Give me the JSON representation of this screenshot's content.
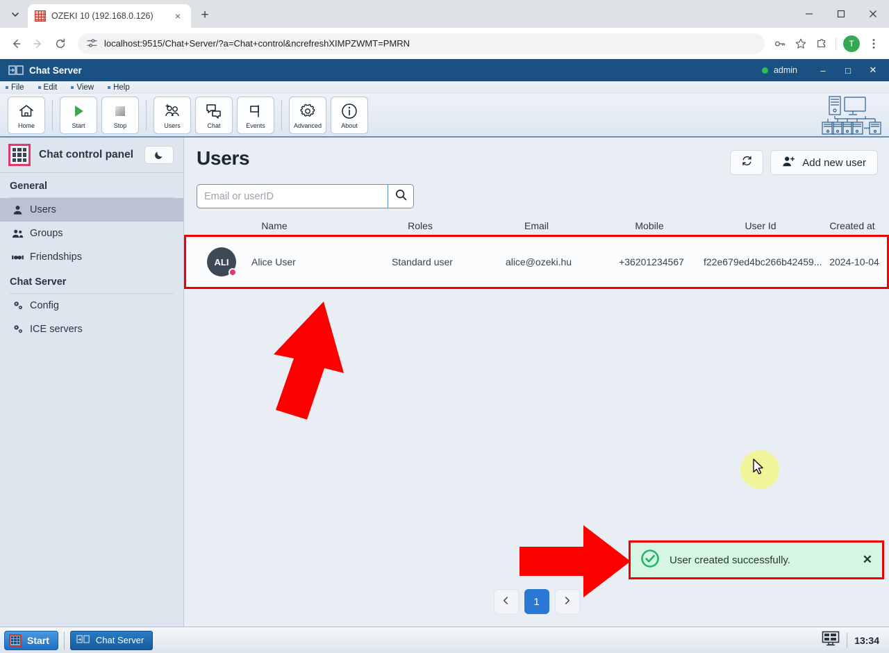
{
  "browser": {
    "tab": {
      "title": "OZEKI 10 (192.168.0.126)",
      "favicon": "ozeki-grid-icon",
      "close": "×"
    },
    "new_tab_label": "+",
    "tab_search_icon": "chevron-down-icon",
    "url": "localhost:9515/Chat+Server/?a=Chat+control&ncrefreshXIMPZWMT=PMRN",
    "site_info_icon": "site-settings-icon",
    "back_icon": "back-arrow-icon",
    "forward_icon": "forward-arrow-icon",
    "reload_icon": "reload-icon",
    "password_icon": "key-icon",
    "bookmark_icon": "star-icon",
    "extensions_icon": "puzzle-icon",
    "profile_initial": "T",
    "menu_icon": "three-dot-menu-icon",
    "window": {
      "minimize": "─",
      "maximize": "□",
      "close": "✕"
    }
  },
  "app": {
    "title": "Chat Server",
    "logo_icon": "chat-server-logo-icon",
    "status_indicator": "online-dot",
    "admin_label": "admin",
    "window_controls": {
      "minimize": "–",
      "maximize": "□",
      "close": "✕"
    },
    "menus": [
      "File",
      "Edit",
      "View",
      "Help"
    ],
    "toolbar": [
      {
        "label": "Home",
        "icon": "home-icon"
      },
      {
        "label": "Start",
        "icon": "play-icon"
      },
      {
        "label": "Stop",
        "icon": "stop-icon"
      },
      {
        "label": "Users",
        "icon": "add-users-icon"
      },
      {
        "label": "Chat",
        "icon": "chat-bubbles-icon"
      },
      {
        "label": "Events",
        "icon": "flag-icon"
      },
      {
        "label": "Advanced",
        "icon": "gear-icon"
      },
      {
        "label": "About",
        "icon": "info-icon"
      }
    ]
  },
  "sidebar": {
    "logo_icon": "ozeki-grid-icon",
    "title": "Chat control panel",
    "darkmode_icon": "moon-icon",
    "sections": [
      {
        "heading": "General",
        "items": [
          {
            "label": "Users",
            "icon": "person-icon",
            "active": true
          },
          {
            "label": "Groups",
            "icon": "people-icon",
            "active": false
          },
          {
            "label": "Friendships",
            "icon": "handshake-icon",
            "active": false
          }
        ]
      },
      {
        "heading": "Chat Server",
        "items": [
          {
            "label": "Config",
            "icon": "gears-icon",
            "active": false
          },
          {
            "label": "ICE servers",
            "icon": "gears-icon",
            "active": false
          }
        ]
      }
    ]
  },
  "main": {
    "page_title": "Users",
    "refresh_icon": "refresh-icon",
    "add_user_label": "Add new user",
    "add_user_icon": "add-person-icon",
    "search": {
      "placeholder": "Email or userID",
      "value": "",
      "button_icon": "search-icon"
    },
    "table": {
      "columns": [
        "Name",
        "Roles",
        "Email",
        "Mobile",
        "User Id",
        "Created at"
      ],
      "rows": [
        {
          "avatar_initials": "ALI",
          "avatar_badge": "status-badge",
          "name": "Alice User",
          "roles": "Standard user",
          "email": "alice@ozeki.hu",
          "mobile": "+36201234567",
          "user_id": "f22e679ed4bc266b42459...",
          "created_at": "2024-10-04"
        }
      ]
    },
    "pagination": {
      "prev_icon": "chevron-left-icon",
      "next_icon": "chevron-right-icon",
      "pages": [
        "1"
      ],
      "current": "1"
    }
  },
  "toast": {
    "icon": "success-check-icon",
    "message": "User created successfully.",
    "close": "✕",
    "accent_color": "#1fb866",
    "background_color": "#d7f5e3"
  },
  "annotations": {
    "highlight_color": "#f00000",
    "arrow_up": "red-arrow-up",
    "arrow_right": "red-arrow-right",
    "cursor": "mouse-cursor"
  },
  "taskbar": {
    "start_label": "Start",
    "start_icon": "ozeki-grid-icon",
    "tasks": [
      {
        "label": "Chat Server",
        "icon": "chat-server-logo-icon"
      }
    ],
    "tray_icon": "display-icon",
    "clock": "13:34"
  }
}
